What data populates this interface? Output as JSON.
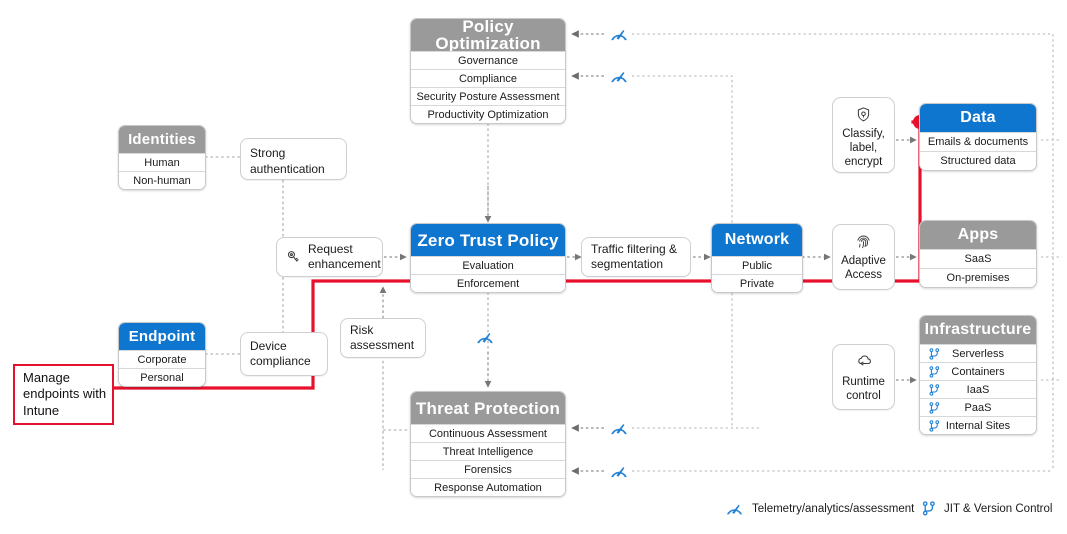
{
  "colors": {
    "blue": "#0f76cf",
    "grey": "#9a9a9a",
    "red": "#e8112d",
    "icon_blue": "#1f7fd4",
    "wire": "#9b9b9b"
  },
  "pillars": {
    "policy_optimization": {
      "title": "Policy Optimization",
      "header_color": "grey",
      "rows": [
        "Governance",
        "Compliance",
        "Security Posture Assessment",
        "Productivity Optimization"
      ]
    },
    "zero_trust_policy": {
      "title": "Zero Trust Policy",
      "header_color": "blue",
      "rows": [
        "Evaluation",
        "Enforcement"
      ]
    },
    "threat_protection": {
      "title": "Threat Protection",
      "header_color": "grey",
      "rows": [
        "Continuous Assessment",
        "Threat Intelligence",
        "Forensics",
        "Response Automation"
      ]
    },
    "identities": {
      "title": "Identities",
      "header_color": "grey",
      "rows": [
        "Human",
        "Non-human"
      ]
    },
    "endpoint": {
      "title": "Endpoint",
      "header_color": "blue",
      "rows": [
        "Corporate",
        "Personal"
      ]
    },
    "network": {
      "title": "Network",
      "header_color": "blue",
      "rows": [
        "Public",
        "Private"
      ]
    },
    "data": {
      "title": "Data",
      "header_color": "blue",
      "rows": [
        "Emails & documents",
        "Structured data"
      ]
    },
    "apps": {
      "title": "Apps",
      "header_color": "grey",
      "rows": [
        "SaaS",
        "On-premises"
      ]
    },
    "infrastructure": {
      "title": "Infrastructure",
      "header_color": "grey",
      "rows": [
        "Serverless",
        "Containers",
        "IaaS",
        "PaaS",
        "Internal Sites"
      ]
    }
  },
  "notes": {
    "strong_authentication": "Strong authentication",
    "request_enhancement": "Request enhancement",
    "device_compliance": "Device compliance",
    "risk_assessment": "Risk assessment",
    "traffic_filtering": "Traffic filtering & segmentation",
    "classify_label_encrypt": "Classify, label, encrypt",
    "adaptive_access": "Adaptive Access",
    "runtime_control": "Runtime control"
  },
  "callout": {
    "text": "Manage endpoints with Intune"
  },
  "legend": [
    {
      "icon": "telemetry-gauge-icon",
      "label": "Telemetry/analytics/assessment"
    },
    {
      "icon": "version-control-icon",
      "label": "JIT & Version Control"
    }
  ],
  "icons": {
    "key": "key-icon",
    "shield_lock": "shield-lock-icon",
    "fingerprint": "fingerprint-icon",
    "cloud_runtime": "cloud-runtime-icon",
    "gauge": "telemetry-gauge-icon",
    "branch": "version-control-icon"
  }
}
